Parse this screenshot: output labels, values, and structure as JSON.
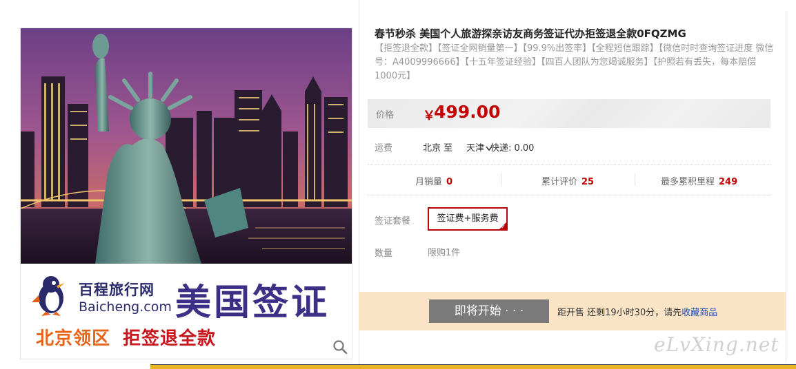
{
  "product": {
    "title": "春节秒杀 美国个人旅游探亲访友商务签证代办拒签退全款0FQZMG",
    "subtitle": "【拒签退全款】【签证全网销量第一】【99.9%出签率】【全程短信跟踪】【微信时时查询签证进度 微信号：A4009996666】【十五年签证经验】【四百人团队为您竭诚服务】【护照若有丢失，每本赔偿1000元】"
  },
  "image": {
    "brand_name": "百程旅行网",
    "brand_domain": "Baicheng.com",
    "headline": "美国签证",
    "region": "北京领区",
    "refund": "拒签退全款"
  },
  "price": {
    "label": "价格",
    "currency": "￥",
    "value": "499.00",
    "color": "#c40000"
  },
  "shipping": {
    "label": "运费",
    "from": "北京 至",
    "to": "天津",
    "fee": "快递: 0.00"
  },
  "stats": {
    "monthly_sales_label": "月销量",
    "monthly_sales_value": "0",
    "reviews_label": "累计评价",
    "reviews_value": "25",
    "miles_label": "最多累积里程",
    "miles_value": "249"
  },
  "sku": {
    "label": "签证套餐",
    "option": "签证费+服务费",
    "selected_color": "#b80000"
  },
  "quantity": {
    "label": "数量",
    "limit": "限购1件"
  },
  "action": {
    "button": "即将开始 · · ·",
    "countdown": "距开售 还剩19小时30分，请先",
    "favorite": "收藏商品",
    "bar_color": "#fbe3c6"
  },
  "watermark": "eLvXing.net",
  "icons": {
    "zoom": "search-icon",
    "dropdown": "chevron-down-icon",
    "check": "check-icon"
  }
}
